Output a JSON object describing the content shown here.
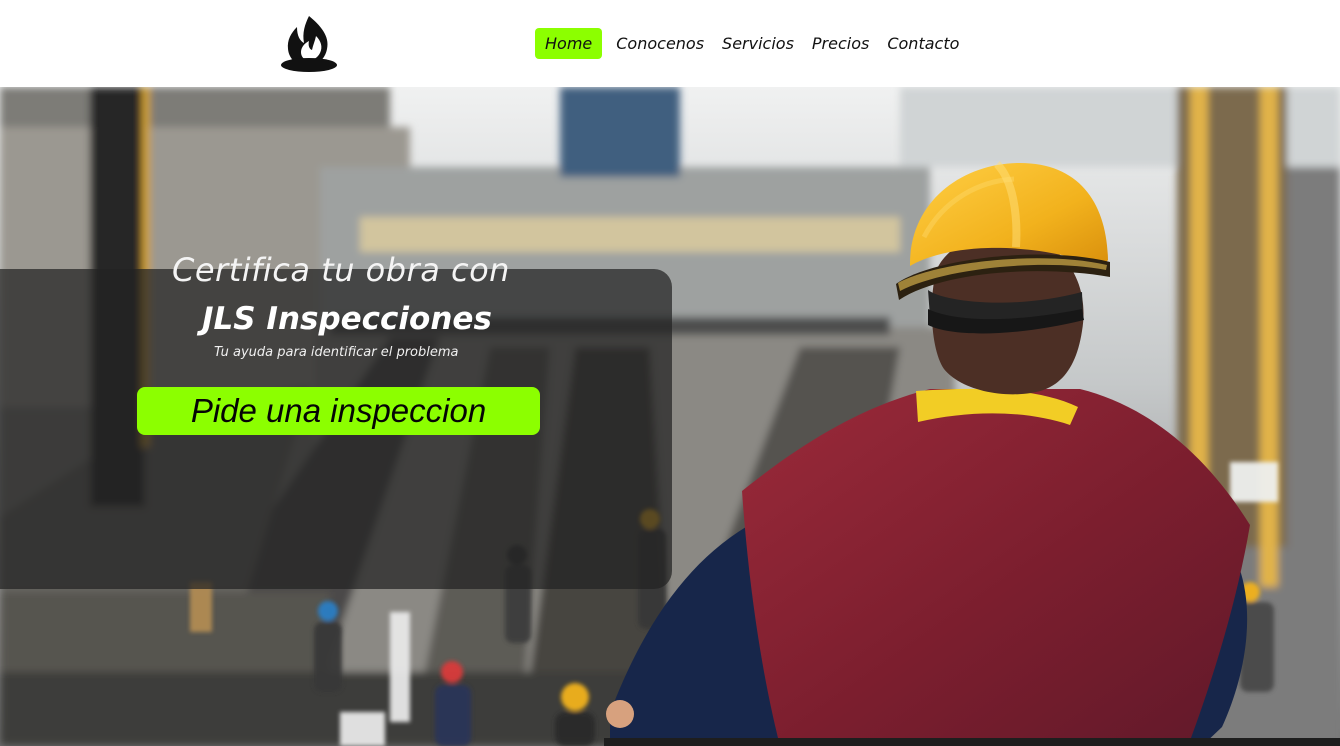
{
  "nav": {
    "items": [
      {
        "label": "Home",
        "active": true
      },
      {
        "label": "Conocenos",
        "active": false
      },
      {
        "label": "Servicios",
        "active": false
      },
      {
        "label": "Precios",
        "active": false
      },
      {
        "label": "Contacto",
        "active": false
      }
    ]
  },
  "hero": {
    "title_line1": "Certifica tu obra con",
    "title_line2": "JLS Inspecciones",
    "subtitle": "Tu ayuda para identificar el problema",
    "cta_label": "Pide una inspeccion"
  },
  "icons": {
    "logo": "flame-icon"
  },
  "colors": {
    "accent": "#8cff00",
    "overlay": "#232323",
    "header_bg": "#ffffff"
  }
}
